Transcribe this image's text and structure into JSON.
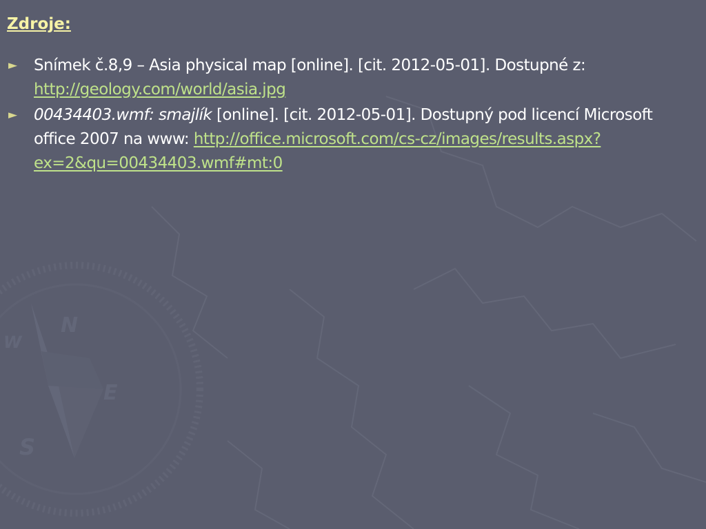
{
  "slide": {
    "title": "Zdroje:",
    "bullet_glyph": "►",
    "references": [
      {
        "text": "Snímek č.8,9 – Asia physical map [online]. [cit. 2012-05-01]. Dostupné z: ",
        "link": "http://geology.com/world/asia.jpg"
      },
      {
        "italic": "00434403.wmf: smajlík",
        "text": " [online]. [cit. 2012-05-01]. Dostupný pod licencí Microsoft office 2007 na www: ",
        "link": "http://office.microsoft.com/cs-cz/images/results.aspx?ex=2&qu=00434403.wmf#mt:0"
      }
    ]
  },
  "background": {
    "color": "#5a5d6e",
    "watermark": "compass-rose",
    "compass_letters": {
      "north": "N",
      "south": "S",
      "east": "E",
      "west": "W"
    }
  },
  "colors": {
    "title": "#f6f3a6",
    "link": "#bfe28a",
    "text": "#ffffff",
    "bullet": "#d9d88f"
  }
}
